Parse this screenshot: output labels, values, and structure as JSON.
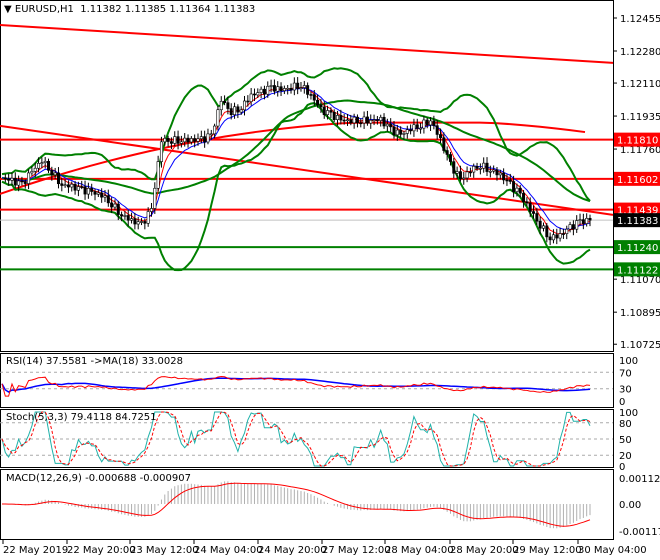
{
  "header": {
    "symbol": "EURUSD,H1",
    "ohlc": "1.11382 1.11385 1.11364 1.11383"
  },
  "chart_data": {
    "type": "candlestick",
    "title": "EURUSD,H1",
    "price_ticks": [
      "1.12455",
      "1.12280",
      "1.12110",
      "1.11935",
      "1.11760",
      "1.11070",
      "1.10895",
      "1.10725"
    ],
    "ylim": [
      1.1071,
      1.1255
    ],
    "time_ticks": [
      "22 May 2019",
      "22 May 20:00",
      "23 May 12:00",
      "24 May 04:00",
      "24 May 20:00",
      "27 May 12:00",
      "28 May 04:00",
      "28 May 20:00",
      "29 May 12:00",
      "30 May 04:00"
    ],
    "closes": [
      1.11607,
      1.1159,
      1.1157,
      1.1164,
      1.11702,
      1.1164,
      1.1157,
      1.1156,
      1.11543,
      1.1153,
      1.11517,
      1.1147,
      1.11411,
      1.1138,
      1.11358,
      1.11437,
      1.11808,
      1.11808,
      1.11808,
      1.11808,
      1.11808,
      1.1183,
      1.1202,
      1.1196,
      1.1198,
      1.12047,
      1.1206,
      1.12084,
      1.12073,
      1.1209,
      1.121,
      1.12047,
      1.11967,
      1.1194,
      1.11914,
      1.11914,
      1.11914,
      1.11914,
      1.11914,
      1.11861,
      1.11835,
      1.1187,
      1.11888,
      1.11914,
      1.11808,
      1.11676,
      1.11596,
      1.11649,
      1.11676,
      1.1165,
      1.11623,
      1.1157,
      1.11517,
      1.11437,
      1.11358,
      1.11289,
      1.11305,
      1.11342,
      1.11374,
      1.11383
    ],
    "levels": [
      {
        "price": 1.1181,
        "label": "1.11810",
        "color": "#ff0000"
      },
      {
        "price": 1.11602,
        "label": "1.11602",
        "color": "#ff0000"
      },
      {
        "price": 1.11439,
        "label": "1.11439",
        "color": "#ff0000"
      },
      {
        "price": 1.11383,
        "label": "1.11383",
        "color": "#000000"
      },
      {
        "price": 1.1124,
        "label": "1.11240",
        "color": "#008000"
      },
      {
        "price": 1.11122,
        "label": "1.11122",
        "color": "#008000"
      }
    ],
    "trendlines": [
      {
        "from": 1.12418,
        "to": 1.12217,
        "color": "#ff0000"
      },
      {
        "from": 1.11883,
        "to": 1.11411,
        "color": "#ff0000"
      }
    ],
    "rsi": {
      "label": "RSI(14) 37.5581  ->MA(18) 33.0028",
      "ticks": [
        "100",
        "70",
        "30",
        "0"
      ]
    },
    "stoch": {
      "label": "Stoch(5,3,3) 79.4118 84.7251",
      "ticks": [
        "100",
        "80",
        "50",
        "20",
        "0"
      ]
    },
    "macd": {
      "label": "MACD(12,26,9) -0.000688 -0.000907",
      "ticks": [
        "0.001125",
        "0.00",
        "-0.001179"
      ]
    }
  }
}
